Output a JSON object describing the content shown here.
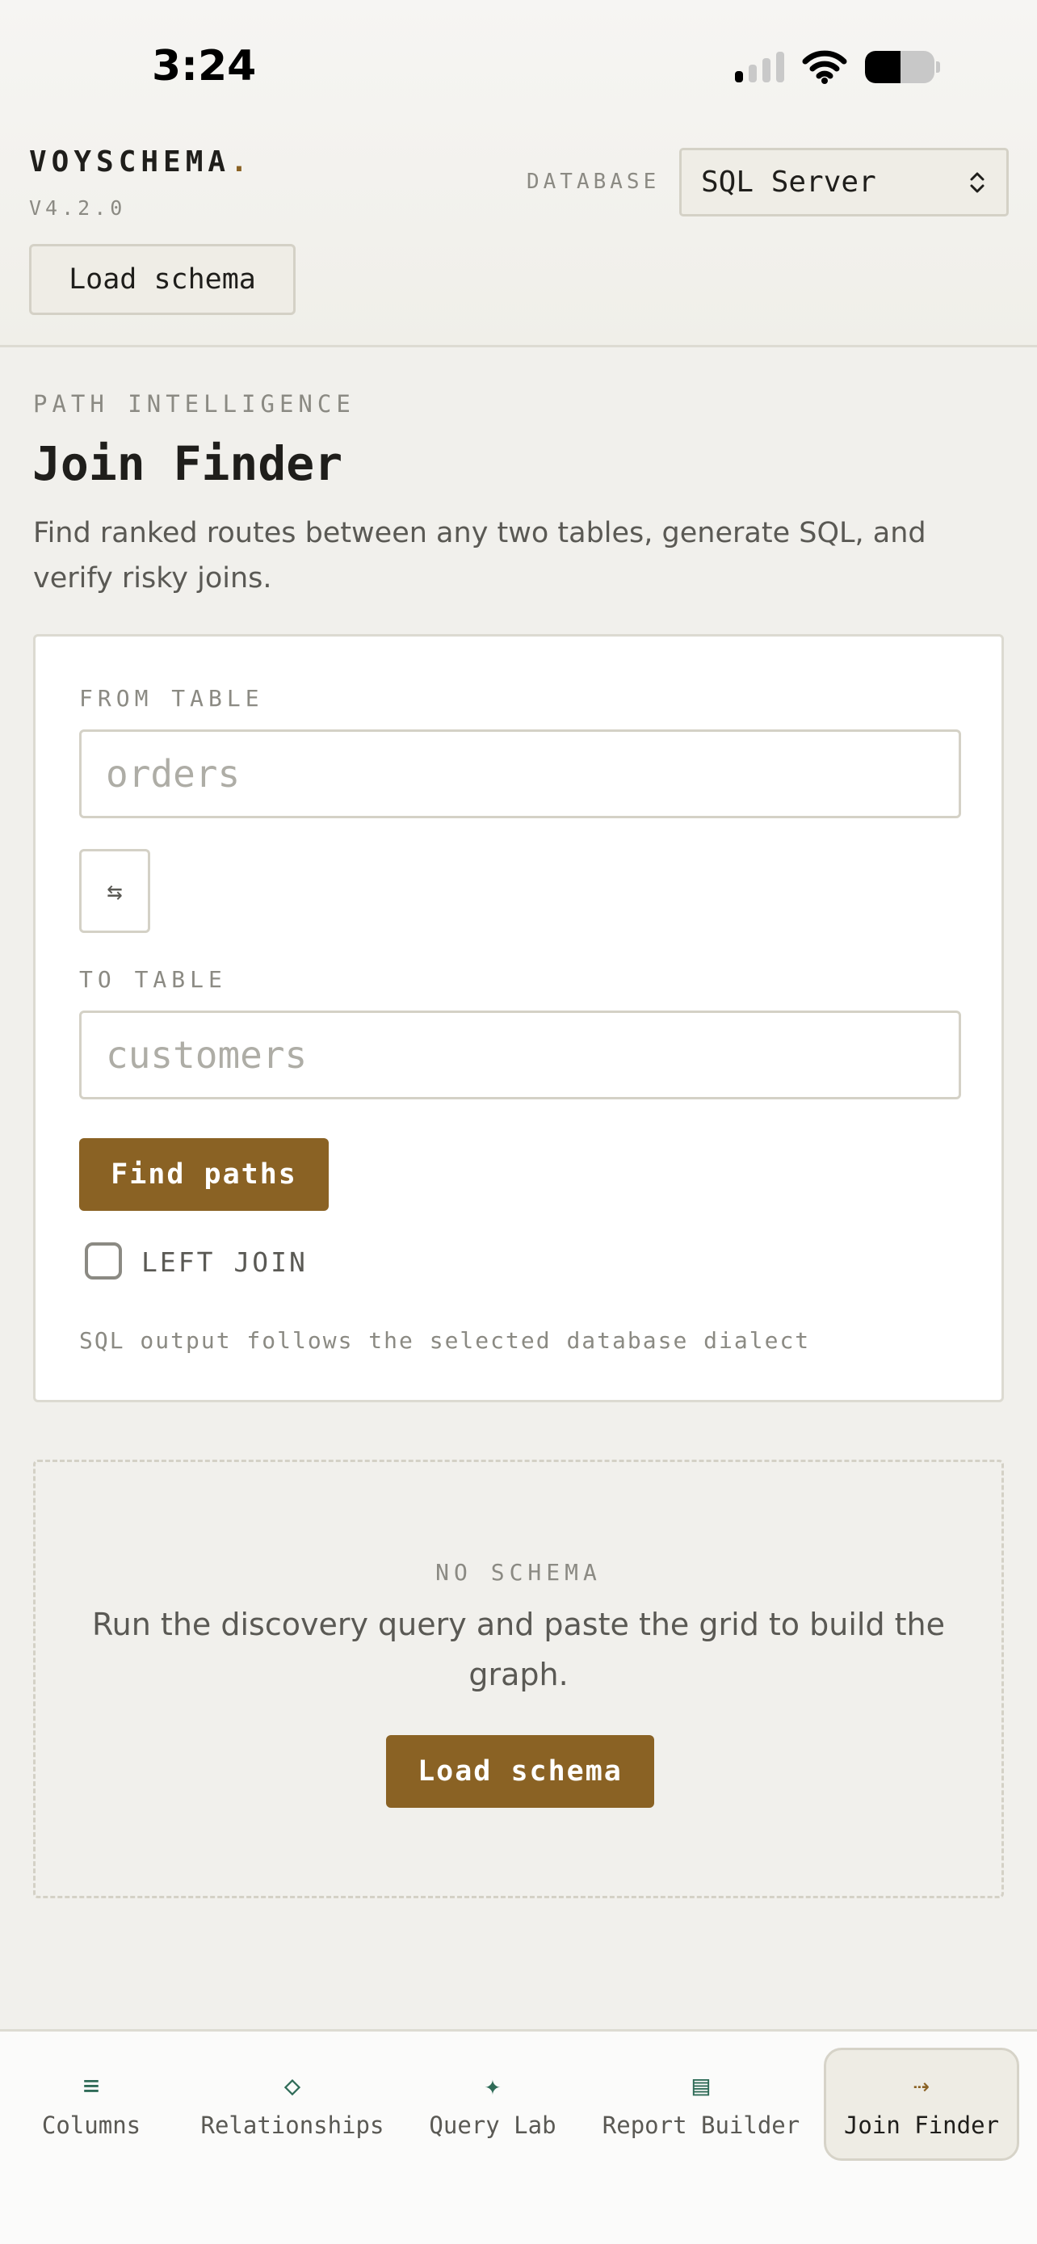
{
  "status_bar": {
    "time": "3:24"
  },
  "header": {
    "brand": "VOYSCHEMA",
    "brand_dot": ".",
    "version": "V4.2.0",
    "database_label": "DATABASE",
    "database_value": "SQL Server",
    "load_schema_label": "Load schema"
  },
  "page": {
    "eyebrow": "PATH INTELLIGENCE",
    "title": "Join Finder",
    "description": "Find ranked routes between any two tables, generate SQL, and verify risky joins."
  },
  "form": {
    "from_label": "FROM TABLE",
    "from_placeholder": "orders",
    "from_value": "",
    "swap_icon": "swap-icon",
    "swap_glyph": "⇆",
    "to_label": "TO TABLE",
    "to_placeholder": "customers",
    "to_value": "",
    "find_paths_label": "Find paths",
    "left_join_label": "LEFT JOIN",
    "left_join_checked": false,
    "hint": "SQL output follows the selected database dialect"
  },
  "empty_state": {
    "eyebrow": "NO SCHEMA",
    "text": "Run the discovery query and paste the grid to build the graph.",
    "button_label": "Load schema"
  },
  "tabbar": {
    "items": [
      {
        "icon": "columns-icon",
        "glyph": "≡",
        "label": "Columns",
        "active": false
      },
      {
        "icon": "relationships-icon",
        "glyph": "◇",
        "label": "Relationships",
        "active": false
      },
      {
        "icon": "query-lab-icon",
        "glyph": "✦",
        "label": "Query Lab",
        "active": false
      },
      {
        "icon": "report-builder-icon",
        "glyph": "▤",
        "label": "Report Builder",
        "active": false
      },
      {
        "icon": "join-finder-icon",
        "glyph": "⇢",
        "label": "Join Finder",
        "active": true
      }
    ]
  },
  "colors": {
    "accent": "#8a6224",
    "icon_green": "#2f6b57",
    "background": "#f1f0ec"
  }
}
